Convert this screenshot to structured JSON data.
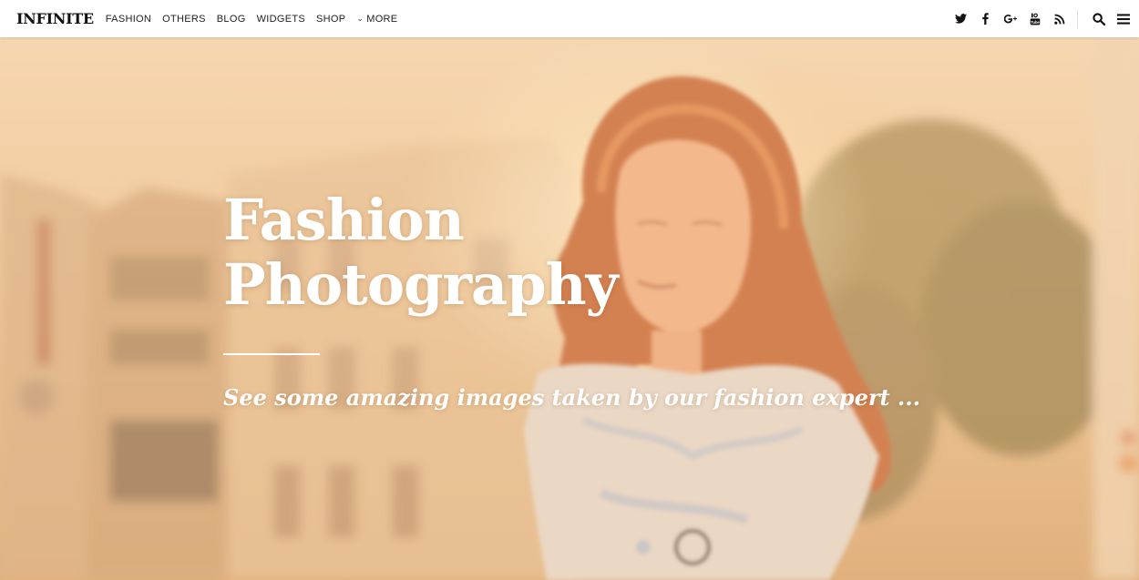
{
  "header": {
    "logo": "INFINITE",
    "nav": [
      {
        "label": "FASHION"
      },
      {
        "label": "OTHERS"
      },
      {
        "label": "BLOG"
      },
      {
        "label": "WIDGETS"
      },
      {
        "label": "SHOP"
      },
      {
        "label": "MORE",
        "icon": "chevron-down-icon"
      }
    ],
    "social_icons": [
      "twitter-icon",
      "facebook-icon",
      "google-plus-icon",
      "youtube-icon",
      "rss-icon"
    ],
    "tools": [
      "search-icon",
      "menu-icon"
    ]
  },
  "hero": {
    "title_line1": "Fashion",
    "title_line2": "Photography",
    "subtitle": "See some amazing images taken by our fashion expert ..."
  }
}
